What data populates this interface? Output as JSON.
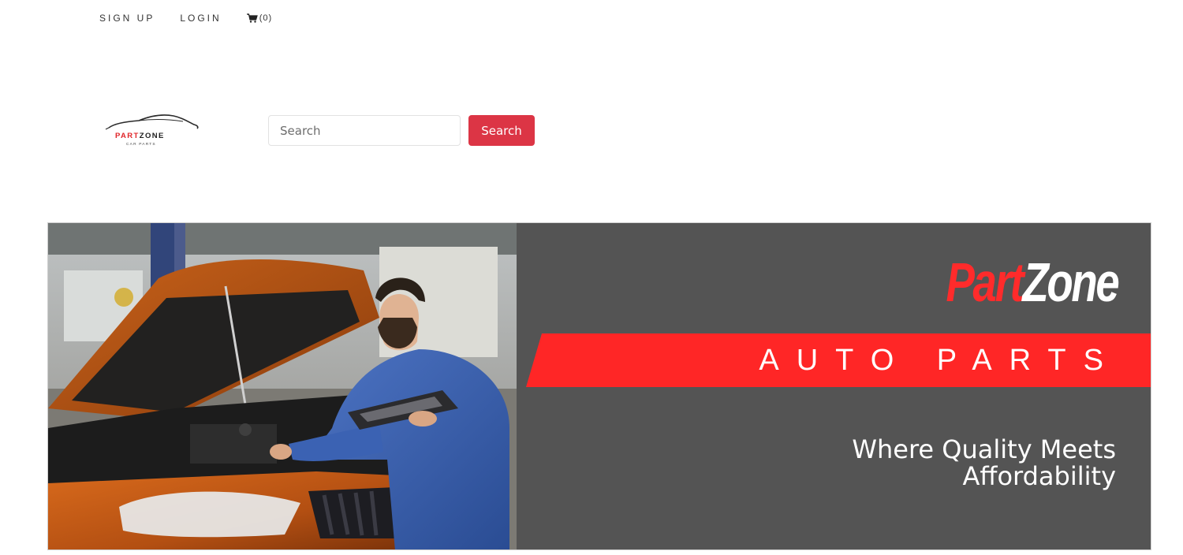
{
  "topnav": {
    "signup_label": "SIGN UP",
    "login_label": "LOGIN",
    "cart_count": "(0)",
    "cart_icon": "cart-icon"
  },
  "header": {
    "logo": {
      "brand_part1": "PART",
      "brand_part2": "ZONE",
      "sub": "CAR PARTS"
    },
    "search": {
      "placeholder": "Search",
      "value": "",
      "button_label": "Search"
    }
  },
  "hero": {
    "brand_part1": "Part",
    "brand_part2": "Zone",
    "band_text": "AUTO PARTS",
    "tagline_line1": "Where Quality Meets",
    "tagline_line2": "Affordability",
    "colors": {
      "panel": "#545454",
      "accent": "#ff2626"
    }
  },
  "colors": {
    "search_button": "#dc3545"
  }
}
